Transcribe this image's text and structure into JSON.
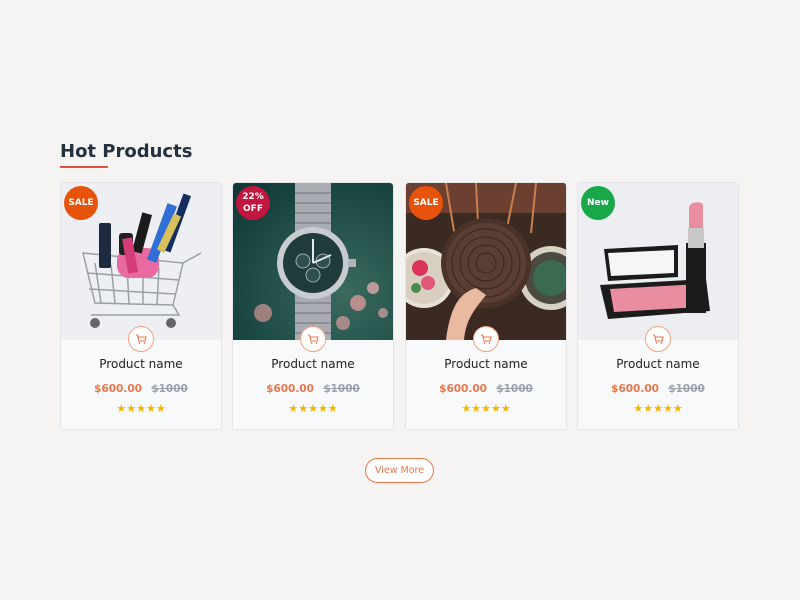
{
  "section": {
    "title": "Hot Products"
  },
  "products": [
    {
      "badge": "SALE",
      "badge_color": "#e8530c",
      "name": "Product name",
      "price": "$600.00",
      "old_price": "$1000",
      "rating": 5,
      "image": "shopping-cart-cosmetics"
    },
    {
      "badge_lines": [
        "22%",
        "OFF"
      ],
      "badge_color": "#c2163e",
      "name": "Product name",
      "price": "$600.00",
      "old_price": "$1000",
      "rating": 5,
      "image": "wristwatch"
    },
    {
      "badge": "SALE",
      "badge_color": "#e8530c",
      "name": "Product name",
      "price": "$600.00",
      "old_price": "$1000",
      "rating": 5,
      "image": "woven-bags"
    },
    {
      "badge": "New",
      "badge_color": "#18a84a",
      "name": "Product name",
      "price": "$600.00",
      "old_price": "$1000",
      "rating": 5,
      "image": "makeup-compact-lipstick"
    }
  ],
  "actions": {
    "view_more": "View More"
  },
  "icons": {
    "cart": "cart-icon",
    "star": "star-icon"
  },
  "colors": {
    "accent": "#e8764a",
    "sale_badge": "#e8530c",
    "discount_badge": "#c2163e",
    "new_badge": "#18a84a",
    "star": "#f3b600",
    "title": "#22303f"
  }
}
